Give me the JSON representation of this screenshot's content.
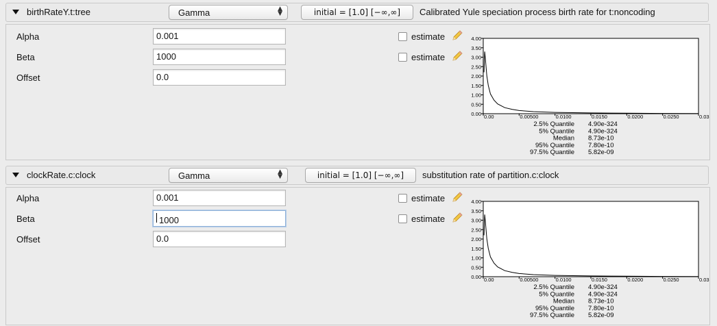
{
  "colors": {
    "panel_bg": "#ececec",
    "focus_ring": "#8fb1d8"
  },
  "panels": [
    {
      "header": {
        "name": "birthRateY.t:tree",
        "distribution": "Gamma",
        "initial": "initial = [1.0] [−∞,∞]",
        "description": "Calibrated Yule speciation process birth rate for t:noncoding"
      },
      "params": [
        {
          "label": "Alpha",
          "value": "0.001",
          "estimate_label": "estimate",
          "estimate_checked": false
        },
        {
          "label": "Beta",
          "value": "1000",
          "estimate_label": "estimate",
          "estimate_checked": false
        },
        {
          "label": "Offset",
          "value": "0.0"
        }
      ],
      "chart_data": {
        "type": "line",
        "title": "",
        "xlabel": "",
        "ylabel": "",
        "xlim": [
          0,
          0.03
        ],
        "ylim": [
          0,
          4.0
        ],
        "x_ticks": [
          "0.00",
          "0.00500",
          "0.0100",
          "0.0150",
          "0.0200",
          "0.0250",
          "0.03"
        ],
        "y_ticks": [
          "0.00",
          "0.50",
          "1.00",
          "1.50",
          "2.00",
          "2.50",
          "3.00",
          "3.50",
          "4.00"
        ],
        "series": [
          {
            "x": [
              0.0001,
              0.0002,
              0.0003,
              0.0005,
              0.0007,
              0.001,
              0.0015,
              0.002,
              0.003,
              0.004,
              0.005,
              0.007,
              0.01,
              0.015,
              0.02,
              0.025,
              0.03
            ],
            "y": [
              2.2,
              3.3,
              2.9,
              2.0,
              1.5,
              1.05,
              0.72,
              0.52,
              0.32,
              0.23,
              0.17,
              0.11,
              0.07,
              0.04,
              0.025,
              0.015,
              0.01
            ]
          }
        ],
        "quantiles": [
          {
            "label": "2.5% Quantile",
            "value": "4.90e-324"
          },
          {
            "label": "5% Quantile",
            "value": "4.90e-324"
          },
          {
            "label": "Median",
            "value": "8.73e-10"
          },
          {
            "label": "95% Quantile",
            "value": "7.80e-10"
          },
          {
            "label": "97.5% Quantile",
            "value": "5.82e-09"
          }
        ]
      }
    },
    {
      "header": {
        "name": "clockRate.c:clock",
        "distribution": "Gamma",
        "initial": "initial = [1.0] [−∞,∞]",
        "description": "substitution rate of partition.c:clock"
      },
      "params": [
        {
          "label": "Alpha",
          "value": "0.001",
          "estimate_label": "estimate",
          "estimate_checked": false
        },
        {
          "label": "Beta",
          "value": "1000",
          "estimate_label": "estimate",
          "estimate_checked": false
        },
        {
          "label": "Offset",
          "value": "0.0"
        }
      ],
      "chart_data": {
        "type": "line",
        "title": "",
        "xlabel": "",
        "ylabel": "",
        "xlim": [
          0,
          0.03
        ],
        "ylim": [
          0,
          4.0
        ],
        "x_ticks": [
          "0.00",
          "0.00500",
          "0.0100",
          "0.0150",
          "0.0200",
          "0.0250",
          "0.03"
        ],
        "y_ticks": [
          "0.00",
          "0.50",
          "1.00",
          "1.50",
          "2.00",
          "2.50",
          "3.00",
          "3.50",
          "4.00"
        ],
        "series": [
          {
            "x": [
              0.0001,
              0.0002,
              0.0003,
              0.0005,
              0.0007,
              0.001,
              0.0015,
              0.002,
              0.003,
              0.004,
              0.005,
              0.007,
              0.01,
              0.015,
              0.02,
              0.025,
              0.03
            ],
            "y": [
              2.2,
              3.3,
              2.9,
              2.0,
              1.5,
              1.05,
              0.72,
              0.52,
              0.32,
              0.23,
              0.17,
              0.11,
              0.07,
              0.04,
              0.025,
              0.015,
              0.01
            ]
          }
        ],
        "quantiles": [
          {
            "label": "2.5% Quantile",
            "value": "4.90e-324"
          },
          {
            "label": "5% Quantile",
            "value": "4.90e-324"
          },
          {
            "label": "Median",
            "value": "8.73e-10"
          },
          {
            "label": "95% Quantile",
            "value": "7.80e-10"
          },
          {
            "label": "97.5% Quantile",
            "value": "5.82e-09"
          }
        ]
      }
    }
  ]
}
